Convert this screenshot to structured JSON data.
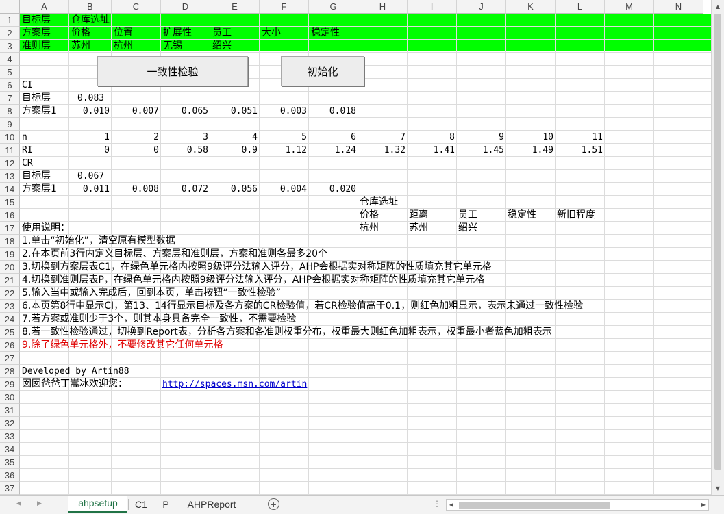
{
  "columns": [
    "A",
    "B",
    "C",
    "D",
    "E",
    "F",
    "G",
    "H",
    "I",
    "J",
    "K",
    "L",
    "M",
    "N"
  ],
  "rows": [
    "1",
    "2",
    "3",
    "4",
    "5",
    "6",
    "7",
    "8",
    "9",
    "10",
    "11",
    "12",
    "13",
    "14",
    "15",
    "16",
    "17",
    "18",
    "19",
    "20",
    "21",
    "22",
    "23",
    "24",
    "25",
    "26",
    "27",
    "28",
    "29",
    "30",
    "31",
    "32",
    "33",
    "34",
    "35",
    "36",
    "37"
  ],
  "header_block": {
    "r1": {
      "a": "目标层",
      "b": "仓库选址"
    },
    "r2": {
      "a": "方案层",
      "b": "价格",
      "c": "位置",
      "d": "扩展性",
      "e": "员工",
      "f": "大小",
      "g": "稳定性"
    },
    "r3": {
      "a": "准则层",
      "b": "苏州",
      "c": "杭州",
      "d": "无锡",
      "e": "绍兴"
    }
  },
  "buttons": {
    "consistency": "一致性检验",
    "init": "初始化"
  },
  "ci": {
    "label": "CI",
    "target_label": "目标层",
    "target_value": "0.083",
    "plan_label": "方案层1",
    "plan_values": [
      "0.010",
      "0.007",
      "0.065",
      "0.051",
      "0.003",
      "0.018"
    ]
  },
  "ri_table": {
    "n_label": "n",
    "n": [
      "1",
      "2",
      "3",
      "4",
      "5",
      "6",
      "7",
      "8",
      "9",
      "10",
      "11"
    ],
    "ri_label": "RI",
    "ri": [
      "0",
      "0",
      "0.58",
      "0.9",
      "1.12",
      "1.24",
      "1.32",
      "1.41",
      "1.45",
      "1.49",
      "1.51"
    ]
  },
  "cr": {
    "label": "CR",
    "target_label": "目标层",
    "target_value": "0.067",
    "plan_label": "方案层1",
    "plan_values": [
      "0.011",
      "0.008",
      "0.072",
      "0.056",
      "0.004",
      "0.020"
    ]
  },
  "side_block": {
    "title": "仓库选址",
    "r16": [
      "价格",
      "距离",
      "员工",
      "稳定性",
      "新旧程度"
    ],
    "r17": [
      "杭州",
      "苏州",
      "绍兴"
    ]
  },
  "instructions": {
    "title": "使用说明：",
    "lines": [
      "1.单击“初始化”，清空原有模型数据",
      "2.在本页前3行内定义目标层、方案层和准则层，方案和准则各最多20个",
      "3.切换到方案层表C1，在绿色单元格内按照9级评分法输入评分，AHP会根据实对称矩阵的性质填充其它单元格",
      "4.切换到准则层表P，在绿色单元格内按照9级评分法输入评分，AHP会根据实对称矩阵的性质填充其它单元格",
      "5.输入当中或输入完成后，回到本页，单击按钮“一致性检验”",
      "6.本页第8行中显示CI，第13、14行显示目标及各方案的CR检验值，若CR检验值高于0.1，则红色加粗显示，表示未通过一致性检验",
      "7.若方案或准则少于3个，则其本身具备完全一致性，不需要检验",
      "8.若一致性检验通过，切换到Report表，分析各方案和各准则权重分布，权重最大则红色加粗表示，权重最小者蓝色加粗表示"
    ],
    "warning": "9.除了绿色单元格外，不要修改其它任何单元格"
  },
  "footer": {
    "developed": "Developed by Artin88",
    "welcome": "囡囡爸爸丁嵩冰欢迎您：",
    "url": "http://spaces.msn.com/artin"
  },
  "tabs": [
    "ahpsetup",
    "C1",
    "P",
    "AHPReport"
  ],
  "active_tab": "ahpsetup",
  "colors": {
    "green": "#00ff00",
    "red": "#e00000",
    "link": "#0000cc",
    "tab_active": "#217346"
  }
}
